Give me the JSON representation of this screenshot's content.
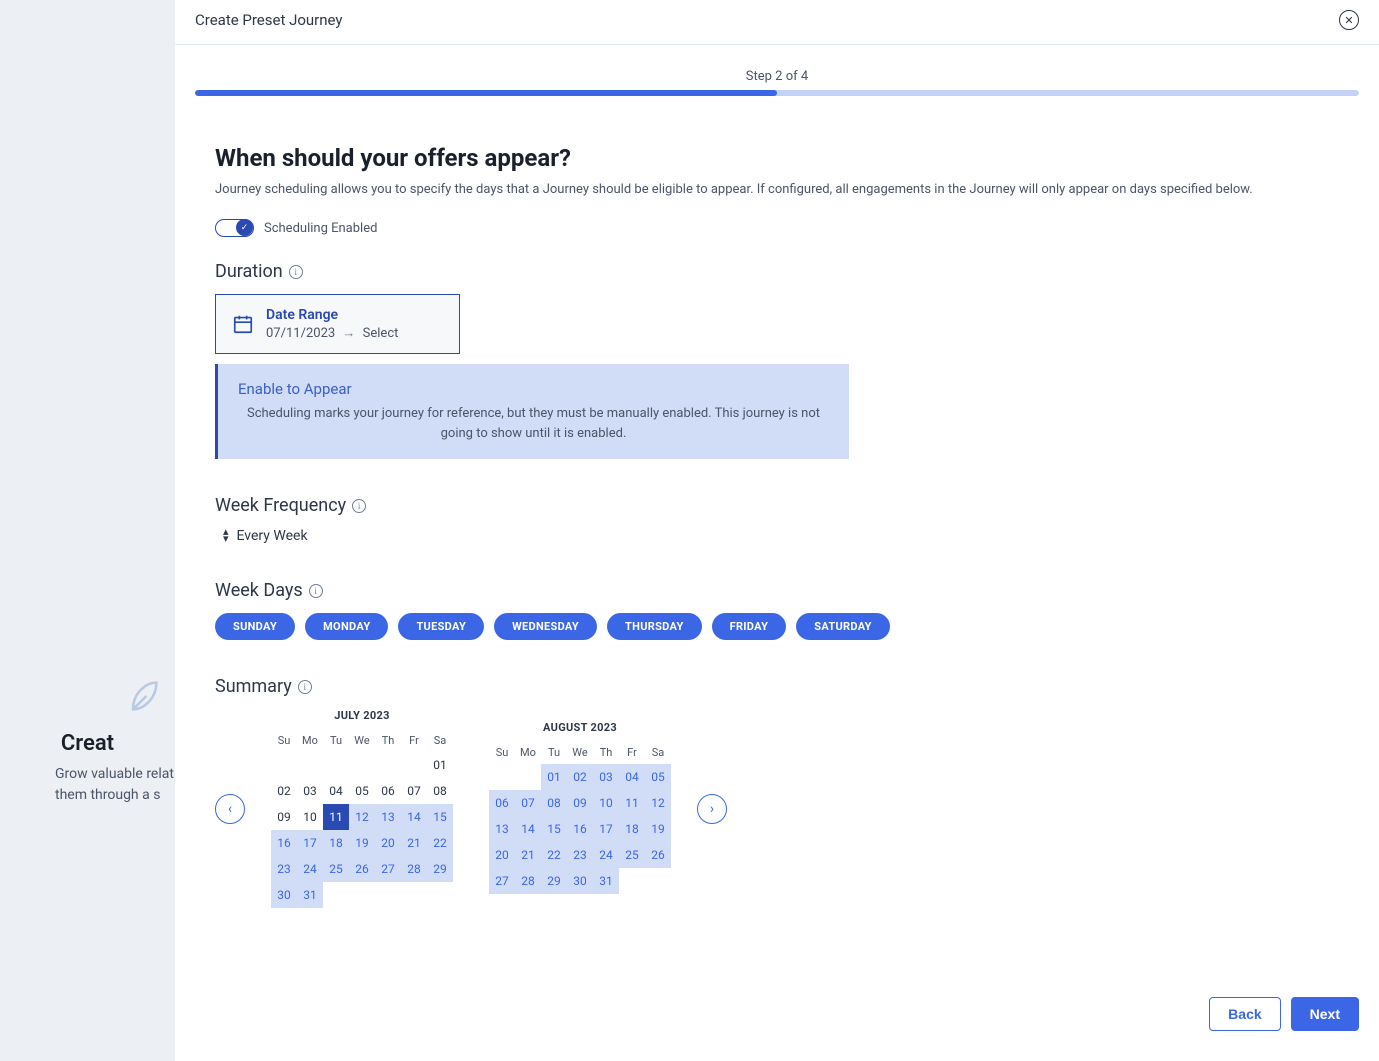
{
  "backdrop": {
    "title": "Creat",
    "line1": "Grow valuable relat",
    "line2": "them through a s"
  },
  "modal": {
    "title": "Create Preset Journey"
  },
  "progress": {
    "label": "Step 2 of 4",
    "percent": 50
  },
  "page": {
    "heading": "When should your offers appear?",
    "subheading": "Journey scheduling allows you to specify the days that a Journey should be eligible to appear. If configured, all engagements in the Journey will only appear on days specified below."
  },
  "toggle": {
    "label": "Scheduling Enabled",
    "on": true
  },
  "duration": {
    "title": "Duration",
    "card_title": "Date Range",
    "start": "07/11/2023",
    "end": "Select"
  },
  "enable_banner": {
    "title": "Enable to Appear",
    "body": "Scheduling marks your journey for reference, but they must be manually enabled. This journey is not going to show until it is enabled."
  },
  "week_frequency": {
    "title": "Week Frequency",
    "value": "Every Week"
  },
  "week_days": {
    "title": "Week Days",
    "days": [
      "SUNDAY",
      "MONDAY",
      "TUESDAY",
      "WEDNESDAY",
      "THURSDAY",
      "FRIDAY",
      "SATURDAY"
    ]
  },
  "summary": {
    "title": "Summary",
    "headers": [
      "Su",
      "Mo",
      "Tu",
      "We",
      "Th",
      "Fr",
      "Sa"
    ],
    "months": [
      {
        "label": "JULY 2023",
        "offset": 6,
        "days": [
          {
            "n": "01",
            "h": false
          },
          {
            "n": "02",
            "h": false
          },
          {
            "n": "03",
            "h": false
          },
          {
            "n": "04",
            "h": false
          },
          {
            "n": "05",
            "h": false
          },
          {
            "n": "06",
            "h": false
          },
          {
            "n": "07",
            "h": false
          },
          {
            "n": "08",
            "h": false
          },
          {
            "n": "09",
            "h": false
          },
          {
            "n": "10",
            "h": false
          },
          {
            "n": "11",
            "sel": true
          },
          {
            "n": "12",
            "h": true
          },
          {
            "n": "13",
            "h": true
          },
          {
            "n": "14",
            "h": true
          },
          {
            "n": "15",
            "h": true
          },
          {
            "n": "16",
            "h": true
          },
          {
            "n": "17",
            "h": true
          },
          {
            "n": "18",
            "h": true
          },
          {
            "n": "19",
            "h": true
          },
          {
            "n": "20",
            "h": true
          },
          {
            "n": "21",
            "h": true
          },
          {
            "n": "22",
            "h": true
          },
          {
            "n": "23",
            "h": true
          },
          {
            "n": "24",
            "h": true
          },
          {
            "n": "25",
            "h": true
          },
          {
            "n": "26",
            "h": true
          },
          {
            "n": "27",
            "h": true
          },
          {
            "n": "28",
            "h": true
          },
          {
            "n": "29",
            "h": true
          },
          {
            "n": "30",
            "h": true
          },
          {
            "n": "31",
            "h": true
          }
        ]
      },
      {
        "label": "AUGUST 2023",
        "offset": 2,
        "days": [
          {
            "n": "01",
            "h": true
          },
          {
            "n": "02",
            "h": true
          },
          {
            "n": "03",
            "h": true
          },
          {
            "n": "04",
            "h": true
          },
          {
            "n": "05",
            "h": true
          },
          {
            "n": "06",
            "h": true
          },
          {
            "n": "07",
            "h": true
          },
          {
            "n": "08",
            "h": true
          },
          {
            "n": "09",
            "h": true
          },
          {
            "n": "10",
            "h": true
          },
          {
            "n": "11",
            "h": true
          },
          {
            "n": "12",
            "h": true
          },
          {
            "n": "13",
            "h": true
          },
          {
            "n": "14",
            "h": true
          },
          {
            "n": "15",
            "h": true
          },
          {
            "n": "16",
            "h": true
          },
          {
            "n": "17",
            "h": true
          },
          {
            "n": "18",
            "h": true
          },
          {
            "n": "19",
            "h": true
          },
          {
            "n": "20",
            "h": true
          },
          {
            "n": "21",
            "h": true
          },
          {
            "n": "22",
            "h": true
          },
          {
            "n": "23",
            "h": true
          },
          {
            "n": "24",
            "h": true
          },
          {
            "n": "25",
            "h": true
          },
          {
            "n": "26",
            "h": true
          },
          {
            "n": "27",
            "h": true
          },
          {
            "n": "28",
            "h": true
          },
          {
            "n": "29",
            "h": true
          },
          {
            "n": "30",
            "h": true
          },
          {
            "n": "31",
            "h": true
          }
        ]
      }
    ]
  },
  "footer": {
    "back": "Back",
    "next": "Next"
  }
}
